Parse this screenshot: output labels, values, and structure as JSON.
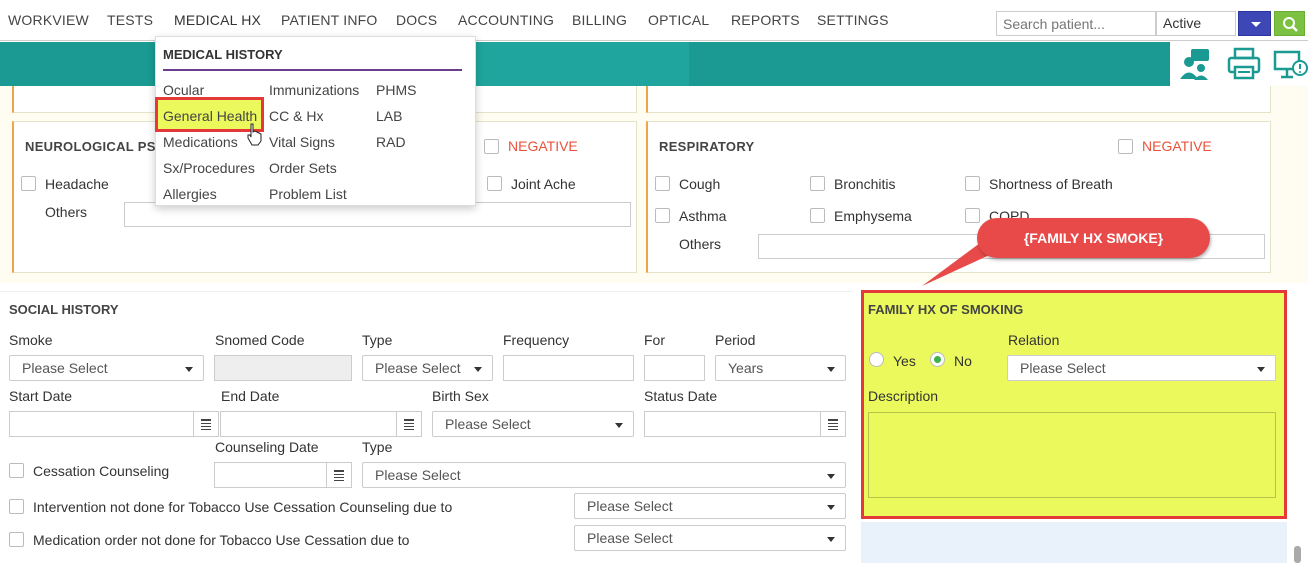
{
  "nav": {
    "items": [
      "WORKVIEW",
      "TESTS",
      "MEDICAL HX",
      "PATIENT INFO",
      "DOCS",
      "ACCOUNTING",
      "BILLING",
      "OPTICAL",
      "REPORTS",
      "SETTINGS"
    ],
    "search_placeholder": "Search patient...",
    "status_value": "Active"
  },
  "menu": {
    "title": "MEDICAL HISTORY",
    "col1": [
      "Ocular",
      "General Health",
      "Medications",
      "Sx/Procedures",
      "Allergies"
    ],
    "col2": [
      "Immunizations",
      "CC & Hx",
      "Vital Signs",
      "Order Sets",
      "Problem List"
    ],
    "col3": [
      "PHMS",
      "LAB",
      "RAD"
    ]
  },
  "neuro": {
    "title": "NEUROLOGICAL PSY",
    "negative": "NEGATIVE",
    "headache": "Headache",
    "joint_ache": "Joint Ache",
    "others": "Others"
  },
  "resp": {
    "title": "RESPIRATORY",
    "negative": "NEGATIVE",
    "cough": "Cough",
    "bronchitis": "Bronchitis",
    "sob": "Shortness of Breath",
    "asthma": "Asthma",
    "emphysema": "Emphysema",
    "copd": "COPD",
    "others": "Others"
  },
  "callout": "{FAMILY HX SMOKE}",
  "social": {
    "title": "SOCIAL HISTORY",
    "smoke_label": "Smoke",
    "smoke_value": "Please Select",
    "snomed_label": "Snomed Code",
    "type_label": "Type",
    "type_value": "Please Select",
    "frequency_label": "Frequency",
    "for_label": "For",
    "period_label": "Period",
    "period_value": "Years",
    "start_date_label": "Start Date",
    "end_date_label": "End Date",
    "birth_sex_label": "Birth Sex",
    "birth_sex_value": "Please Select",
    "status_date_label": "Status Date",
    "counseling_date_label": "Counseling Date",
    "type2_label": "Type",
    "type2_value": "Please Select",
    "cessation": "Cessation Counseling",
    "intervention": "Intervention not done for Tobacco Use Cessation Counseling due to",
    "intervention_value": "Please Select",
    "medication": "Medication order not done for Tobacco Use Cessation due to",
    "medication_value": "Please Select"
  },
  "family": {
    "title": "FAMILY HX OF SMOKING",
    "yes": "Yes",
    "no": "No",
    "relation_label": "Relation",
    "relation_value": "Please Select",
    "description_label": "Description",
    "selected": "No"
  },
  "colors": {
    "accent_purple": "#6a3d8f",
    "teal": "#1a9a93",
    "highlight": "#ebf95c",
    "callout_red": "#e84a4a",
    "negative_red": "#e8533d"
  }
}
